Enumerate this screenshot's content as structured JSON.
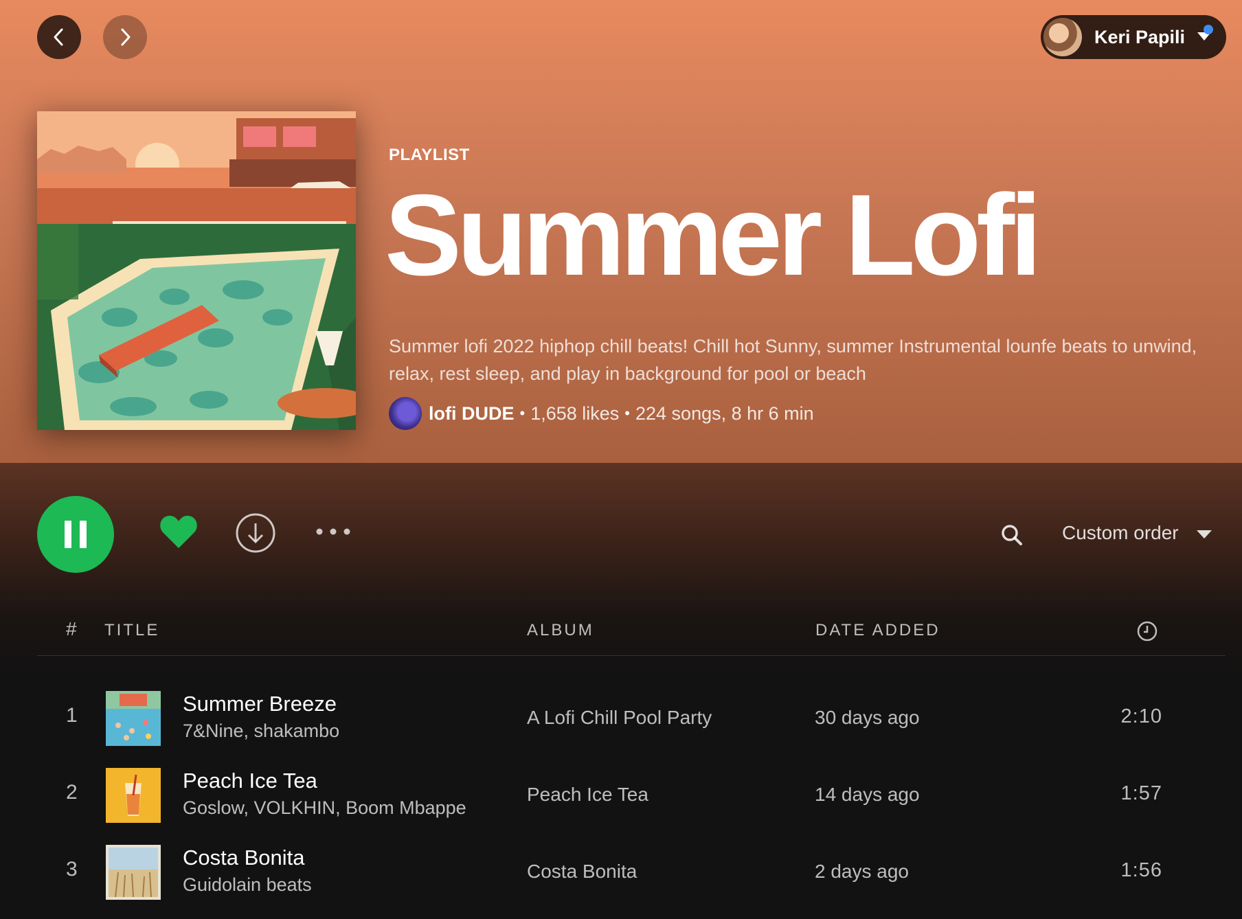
{
  "user": {
    "name": "Keri Papili"
  },
  "playlist": {
    "type_label": "PLAYLIST",
    "title": "Summer Lofi",
    "description": "Summer lofi 2022 hiphop chill beats! Chill hot Sunny, summer Instrumental lounfe beats to unwind, relax, rest sleep, and play in background for pool or beach",
    "owner": "lofi DUDE",
    "separator": "•",
    "likes": "1,658 likes",
    "songs_duration": "224 songs, 8 hr 6 min"
  },
  "controls": {
    "sort_label": "Custom order",
    "liked": true,
    "playing": true
  },
  "table": {
    "headers": {
      "number": "#",
      "title": "TITLE",
      "album": "ALBUM",
      "date_added": "DATE ADDED"
    },
    "rows": [
      {
        "number": "1",
        "title": "Summer Breeze",
        "artists": "7&Nine, shakambo",
        "album": "A Lofi Chill Pool Party",
        "date_added": "30 days ago",
        "duration": "2:10"
      },
      {
        "number": "2",
        "title": "Peach Ice Tea",
        "artists": "Goslow, VOLKHIN, Boom Mbappe",
        "album": "Peach Ice Tea",
        "date_added": "14 days ago",
        "duration": "1:57"
      },
      {
        "number": "3",
        "title": "Costa Bonita",
        "artists": "Guidolain beats",
        "album": "Costa Bonita",
        "date_added": "2 days ago",
        "duration": "1:56"
      }
    ]
  },
  "colors": {
    "accent": "#1db954",
    "hero_top": "#e88a5f",
    "hero_bottom": "#a9603e",
    "background": "#121212",
    "notification": "#3d8eee"
  },
  "icons": [
    "chevron-left-icon",
    "chevron-right-icon",
    "caret-down-icon",
    "pause-icon",
    "heart-icon",
    "download-icon",
    "more-icon",
    "search-icon",
    "clock-icon"
  ]
}
